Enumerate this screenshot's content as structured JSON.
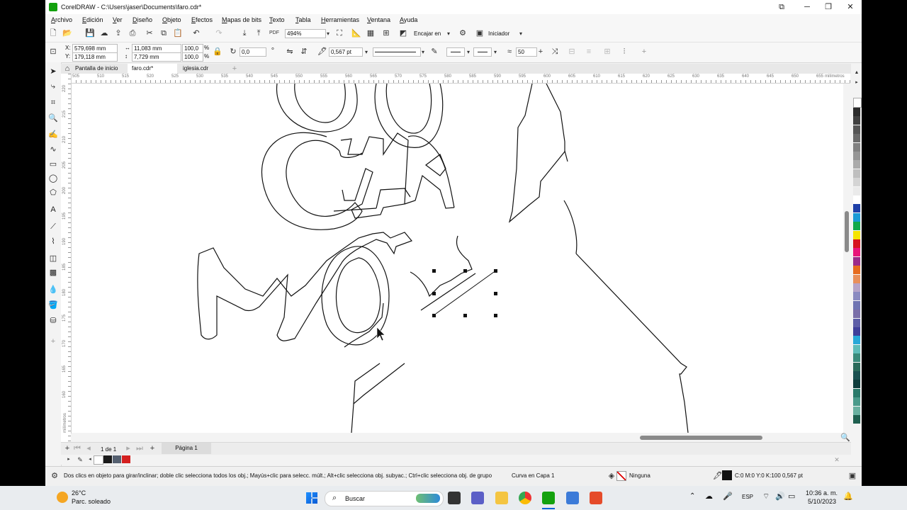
{
  "window": {
    "title": "CorelDRAW - C:\\Users\\jaser\\Documents\\faro.cdr*",
    "min": "─",
    "max": "❐",
    "close": "✕",
    "extra": "⧉"
  },
  "menu": [
    "Archivo",
    "Edición",
    "Ver",
    "Diseño",
    "Objeto",
    "Efectos",
    "Mapas de bits",
    "Texto",
    "Tabla",
    "Herramientas",
    "Ventana",
    "Ayuda"
  ],
  "toolbar": {
    "zoom": "494%",
    "snap_label": "Encajar en",
    "workspace_label": "Iniciador"
  },
  "props": {
    "x_label": "X:",
    "x": "579,698 mm",
    "y_label": "Y:",
    "y": "179,118 mm",
    "w": "11,083 mm",
    "h": "7,729 mm",
    "sx": "100,0",
    "sy": "100,0",
    "pct": "%",
    "angle": "0,0",
    "outline": "0,567 pt",
    "smooth": "50"
  },
  "tabs": [
    "Pantalla de inicio",
    "faro.cdr*",
    "iglesia.cdr"
  ],
  "ruler": {
    "h": [
      "505",
      "510",
      "515",
      "520",
      "525",
      "530",
      "535",
      "540",
      "545",
      "550",
      "555",
      "560",
      "565",
      "570",
      "575",
      "580",
      "585",
      "590",
      "595",
      "600",
      "605",
      "610",
      "615",
      "620",
      "625",
      "630",
      "635",
      "640",
      "645",
      "650",
      "655"
    ],
    "h_unit": "milímetros",
    "v": [
      "220",
      "215",
      "210",
      "205",
      "200",
      "195",
      "190",
      "185",
      "180",
      "175",
      "170",
      "165",
      "160"
    ],
    "v_unit": "milímetros"
  },
  "pagenav": {
    "count": "1 de 1",
    "page": "Página 1"
  },
  "status": {
    "hint": "Dos clics en objeto para girar/inclinar; doble clic selecciona todos los obj.; Mayús+clic para selecc. múlt.; Alt+clic selecciona obj. subyac.; Ctrl+clic selecciona obj. de grupo",
    "object": "Curva en Capa 1",
    "fill": "Ninguna",
    "outline": "C:0 M:0 Y:0 K:100  0,567 pt"
  },
  "taskbar": {
    "temp": "26°C",
    "weather": "Parc. soleado",
    "search": "Buscar",
    "lang": "ESP",
    "time": "10:36 a. m.",
    "date": "5/10/2023"
  },
  "colors": {
    "palette": [
      "#ffffff",
      "#2b2b2b",
      "#404040",
      "#555555",
      "#6a6a6a",
      "#808080",
      "#959595",
      "#aaaaaa",
      "#bfbfbf",
      "#d4d4d4",
      "#eaeaea",
      "#ffffff",
      "#1e3fa8",
      "#1a9ad6",
      "#12a84a",
      "#f4e400",
      "#d6141e",
      "#e8157a",
      "#9b2a8a",
      "#e66b1e",
      "#e88f5a",
      "#b5a3c8",
      "#8a8ac0",
      "#6f74b2",
      "#7a6ea8",
      "#5d5da6",
      "#3f3f9a",
      "#28a8d8",
      "#5fbcb8",
      "#3a8a7a",
      "#2a6a5a",
      "#1a5050",
      "#0f3c3c",
      "#2a7a6a",
      "#4a9a8a",
      "#6ab0a0",
      "#1f5f4f"
    ],
    "docpal": [
      "#ffffff",
      "#1a1a1a",
      "#556070",
      "#d42020"
    ]
  }
}
